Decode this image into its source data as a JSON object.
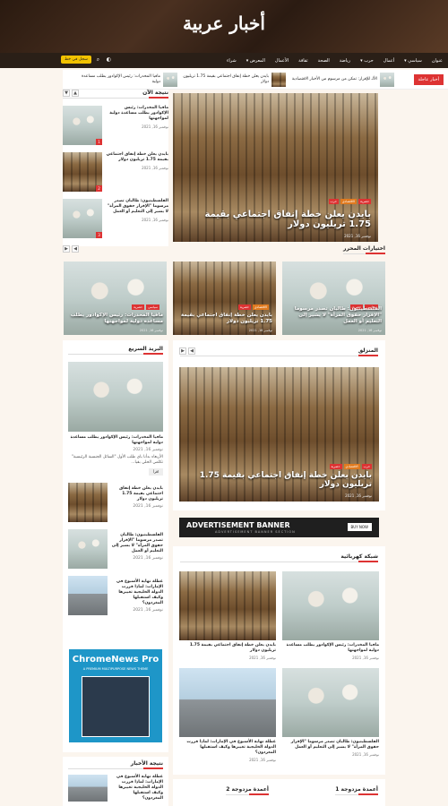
{
  "site": {
    "title": "أخبار عربية"
  },
  "nav": {
    "items": [
      "عنوان",
      "سياسي ▾",
      "أعمال",
      "حرب ▾",
      "رياضة",
      "الصحة",
      "ثقافة",
      "الأعمال",
      "المعرض ▾",
      "شراء"
    ],
    "subscribe": "سجل في خط"
  },
  "breaking": {
    "label": "أخبار عاجلة",
    "items": [
      {
        "text": "الألـ للإقرار: تمكن من مرسوم من الأخبار الاقتصادية"
      },
      {
        "text": "بايدن يعلن خطة إنفاق اجتماعي بقيمة 1.75 تريليون دولار"
      },
      {
        "text": "مافيا المخدرات: رئيس الإكوادور يطلب مساعدة دولية"
      }
    ]
  },
  "trending": {
    "title": "نتيجة الآن",
    "items": [
      {
        "title": "مافيا المخدرات: رئيس الإكوادور يطلب مساعدة دولية لمواجهتها",
        "date": "نوفمبر 16, 2021",
        "num": "1"
      },
      {
        "title": "بايدن يعلن خطة إنفاق اجتماعي بقيمة 1.75 تريليون دولار",
        "date": "نوفمبر 16, 2021",
        "num": "2"
      },
      {
        "title": "الفلسطينيون: ظالبان تصدر مرسوما \"الإقرار حقوق المرأة\" لا يشير إلى التعليم أو العمل",
        "date": "نوفمبر 16, 2021",
        "num": "3"
      }
    ]
  },
  "hero": {
    "title": "بايدن يعلن خطة إنفاق اجتماعي بقيمة 1.75 تريليون دولار",
    "date": "نوفمبر 16, 2021",
    "tags": [
      "حصرية",
      "الاقتصادي",
      "حرب"
    ]
  },
  "editor": {
    "title": "اختيارات المحرر",
    "cards": [
      {
        "title": "مافيا المخدرات: رئيس الإكوادور يطلب مساعدة دولية لمواجهتها",
        "date": "نوفمبر 16, 2021",
        "tags": [
          "سياسي",
          "حصرية"
        ]
      },
      {
        "title": "بايدن يعلن خطة إنفاق اجتماعي بقيمة 1.75 تريليون دولار",
        "date": "نوفمبر 16, 2021",
        "tags": [
          "الاقتصادي",
          "حصرية"
        ]
      },
      {
        "title": "الفلسطينيون: طالبان تصدر مرسوما \"الإقرار حقوق المرأة\" لا يشير إلى التعليم أو العمل",
        "date": "نوفمبر 16, 2021",
        "tags": [
          "سياسي",
          "حصرية"
        ]
      }
    ]
  },
  "home": {
    "title": "المنزلق",
    "hero_title": "بايدن يعلن خطة إنفاق اجتماعي بقيمة 1.75 تريليون دولار",
    "date": "نوفمبر 16, 2021",
    "tags": [
      "حرب",
      "الاقتصادي",
      "حصرية"
    ]
  },
  "ad": {
    "title": "ADVERTISEMENT BANNER",
    "sub": "ADVERTISEMENT BANNER SECTION",
    "button": "BUY NOW"
  },
  "electric": {
    "title": "شبكة كهربائية",
    "cards": [
      {
        "title": "مافيا المخدرات: رئيس الإكوادور يطلب مساعدة دولية لمواجهتها",
        "date": "نوفمبر 16, 2021",
        "img": "women"
      },
      {
        "title": "بايدن يعلن خطة إنفاق اجتماعي بقيمة 1.75 تريليون دولار",
        "date": "نوفمبر 16, 2021",
        "img": "library"
      },
      {
        "title": "الفلسطينيون: طالبان تصدر مرسوما \"الإقرار حقوق المرأة\" لا يشير إلى التعليم أو العمل",
        "date": "نوفمبر 16, 2021",
        "img": "women"
      },
      {
        "title": "عطلة نهاية الأسبوع في الإمارات: لماذا قررت الدولة الخليجية تغييرها وكيف استقبلها المغردون؟",
        "date": "نوفمبر 16, 2021",
        "img": "plane"
      }
    ]
  },
  "double": {
    "col1": "أعمدة مزدوجة 1",
    "col2": "أعمدة مزدوجة 2"
  },
  "sidebar": {
    "title": "البريد السريع",
    "main_title": "مافيا المخدرات: رئيس الإكوادور يطلب مساعدة دولية لمواجهتها",
    "main_date": "نوفمبر 16, 2021",
    "excerpt": "الأربعاء بدأنا باي طلب الأول \"السائل الجنسية الرئيسية\" تكلمي الحلي بقيا...",
    "more": "اقرأ",
    "list": [
      {
        "title": "بايدن يعلن خطة إنفاق اجتماعي بقيمة 1.75 تريليون دولار",
        "date": "نوفمبر 16, 2021"
      },
      {
        "title": "الفلسطينيون: طالبان تصدر مرسوما \"الإقرار حقوق المرأة\" لا يشير إلى التعليم أو العمل",
        "date": "نوفمبر 16, 2021"
      },
      {
        "title": "عطلة نهاية الأسبوع في الإمارات: لماذا قررت الدولة الخليجية تغييرها وكيف استقبلها المغردون؟",
        "date": "نوفمبر 16, 2021"
      }
    ]
  },
  "chrome_ad": {
    "title": "ChromeNews Pro",
    "sub": "A PREMIUM MULTIPURPOSE NEWS THEME"
  },
  "news_side": {
    "title": "نتيجة الأخبار",
    "item": "عطلة نهاية الأسبوع في الإمارات: لماذا قررت الدولة الخليجية تغييرها وكيف استقبلها المغردون؟"
  },
  "colors": {
    "accent": "#dd3333",
    "nav_bg": "#2a1f17",
    "subscribe": "#f2c200"
  }
}
